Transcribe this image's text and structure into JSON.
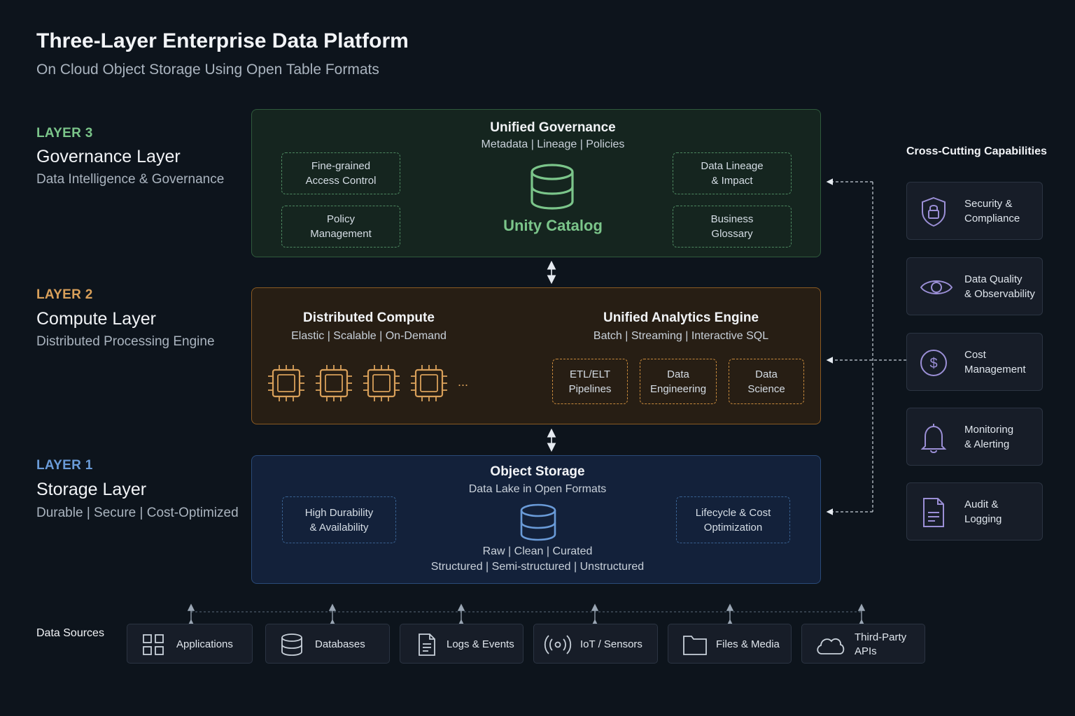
{
  "header": {
    "title": "Three-Layer Enterprise Data Platform",
    "subtitle": "On Cloud Object Storage Using Open Table Formats"
  },
  "colors": {
    "background": "#0d141c",
    "governance_accent": "#7bc58a",
    "compute_accent": "#d9a05a",
    "storage_accent": "#6a9bd8",
    "cross_cutting_accent": "#9b8fd6"
  },
  "layers": {
    "governance": {
      "tag": "LAYER 3",
      "name": "Governance Layer",
      "description": "Data Intelligence & Governance",
      "panel_title": "Unified Governance",
      "panel_subtitle": "Metadata | Lineage | Policies",
      "center_label": "Unity Catalog",
      "center_icon": "database-icon",
      "left_boxes": [
        "Fine-grained\nAccess Control",
        "Policy\nManagement"
      ],
      "right_boxes": [
        "Data Lineage\n& Impact",
        "Business\nGlossary"
      ]
    },
    "compute": {
      "tag": "LAYER 2",
      "name": "Compute Layer",
      "description": "Distributed Processing Engine",
      "left_title": "Distributed Compute",
      "left_subtitle": "Elastic | Scalable | On-Demand",
      "chip_icon": "cpu-chip-icon",
      "ellipsis": "...",
      "right_title": "Unified Analytics Engine",
      "right_subtitle": "Batch | Streaming | Interactive SQL",
      "boxes": [
        "ETL/ELT\nPipelines",
        "Data\nEngineering",
        "Data\nScience"
      ]
    },
    "storage": {
      "tag": "LAYER 1",
      "name": "Storage Layer",
      "description": "Durable | Secure | Cost-Optimized",
      "panel_title": "Object Storage",
      "panel_subtitle": "Data Lake in Open Formats",
      "center_icon": "database-icon",
      "left_box": "High Durability\n& Availability",
      "right_box": "Lifecycle & Cost\nOptimization",
      "zones": "Raw | Clean | Curated",
      "data_types": "Structured | Semi-structured | Unstructured"
    }
  },
  "cross_cutting": {
    "title": "Cross-Cutting Capabilities",
    "items": [
      {
        "label": "Security &\nCompliance",
        "icon": "shield-lock-icon"
      },
      {
        "label": "Data Quality\n& Observability",
        "icon": "eye-icon"
      },
      {
        "label": "Cost\nManagement",
        "icon": "dollar-icon"
      },
      {
        "label": "Monitoring\n& Alerting",
        "icon": "bell-icon"
      },
      {
        "label": "Audit &\nLogging",
        "icon": "document-icon"
      }
    ]
  },
  "data_sources": {
    "title": "Data Sources",
    "items": [
      {
        "label": "Applications",
        "icon": "grid-icon"
      },
      {
        "label": "Databases",
        "icon": "database-icon"
      },
      {
        "label": "Logs & Events",
        "icon": "document-icon"
      },
      {
        "label": "IoT / Sensors",
        "icon": "broadcast-icon"
      },
      {
        "label": "Files & Media",
        "icon": "folder-icon"
      },
      {
        "label": "Third-Party\nAPIs",
        "icon": "cloud-icon"
      }
    ]
  }
}
